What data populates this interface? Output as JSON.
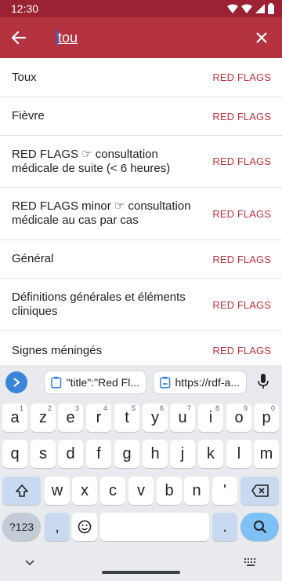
{
  "status_bar": {
    "time": "12:30"
  },
  "search": {
    "query": "tou"
  },
  "results": [
    {
      "title": "Toux",
      "tag": "RED FLAGS"
    },
    {
      "title": "Fièvre",
      "tag": "RED FLAGS"
    },
    {
      "title": "RED FLAGS ☞ consultation médicale de suite (< 6 heures)",
      "tag": "RED FLAGS"
    },
    {
      "title": "RED FLAGS minor ☞ consultation médicale au cas par cas",
      "tag": "RED FLAGS"
    },
    {
      "title": "Général",
      "tag": "RED FLAGS"
    },
    {
      "title": "Définitions générales et éléments cliniques",
      "tag": "RED FLAGS"
    },
    {
      "title": "Signes méningés",
      "tag": "RED FLAGS"
    }
  ],
  "keyboard": {
    "clip1": "\"title\":\"Red Fl...",
    "clip2": "https://rdf-a...",
    "row1": [
      {
        "k": "a",
        "h": "1"
      },
      {
        "k": "z",
        "h": "2"
      },
      {
        "k": "e",
        "h": "3"
      },
      {
        "k": "r",
        "h": "4"
      },
      {
        "k": "t",
        "h": "5"
      },
      {
        "k": "y",
        "h": "6"
      },
      {
        "k": "u",
        "h": "7"
      },
      {
        "k": "i",
        "h": "8"
      },
      {
        "k": "o",
        "h": "9"
      },
      {
        "k": "p",
        "h": "0"
      }
    ],
    "row2": [
      "q",
      "s",
      "d",
      "f",
      "g",
      "h",
      "j",
      "k",
      "l",
      "m"
    ],
    "row3": [
      "w",
      "x",
      "c",
      "v",
      "b",
      "n",
      "'"
    ],
    "sym_label": "?123",
    "comma": ",",
    "period": "."
  },
  "colors": {
    "app_bar": "#b4313f",
    "status_bar": "#9b2232",
    "tag": "#c0323f",
    "enter": "#7fc0f5"
  }
}
